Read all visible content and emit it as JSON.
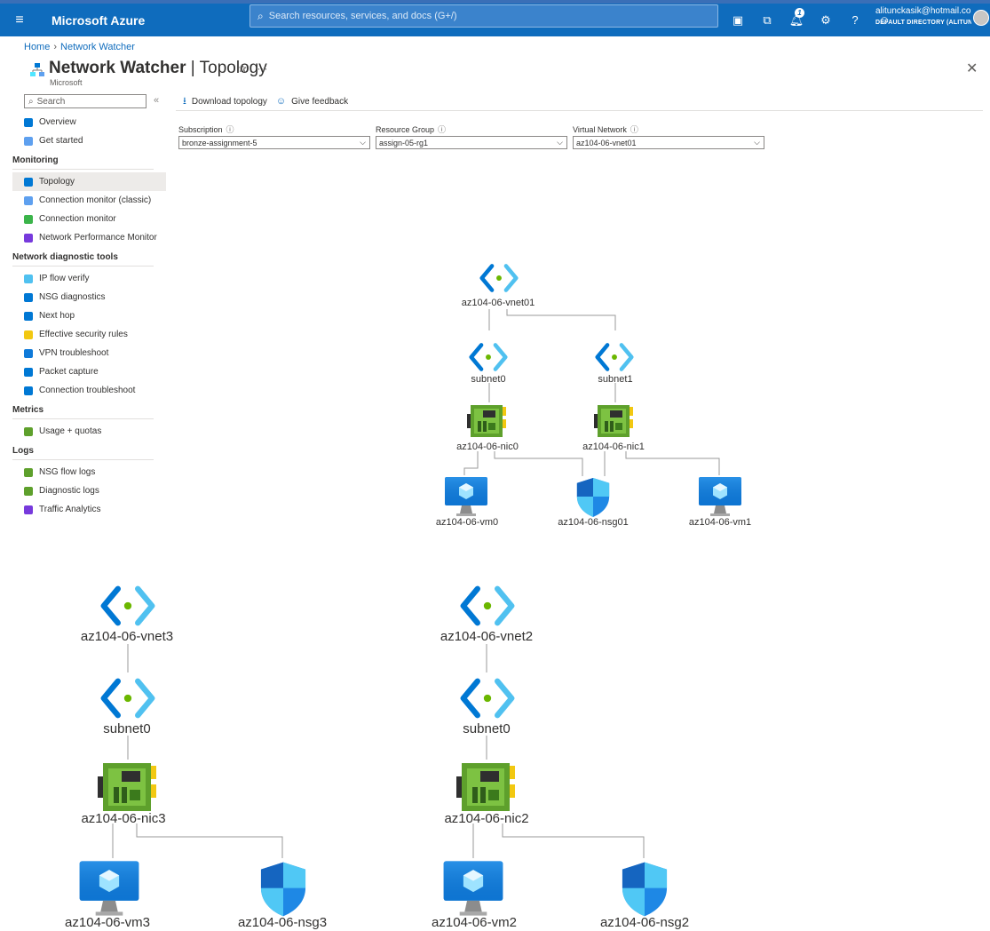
{
  "app": {
    "menu_glyph": "≡",
    "brand": "Microsoft Azure",
    "search_placeholder": "Search resources, services, and docs (G+/)",
    "notification_count": "1",
    "account_email": "alitunckasik@hotmail.co...",
    "account_directory": "DEFAULT DIRECTORY (ALITUNCK...",
    "accent_color": "#0f6cbd"
  },
  "breadcrumb": [
    "Home",
    "Network Watcher"
  ],
  "page": {
    "title_main": "Network Watcher",
    "title_sep": " | ",
    "title_sub": "Topology",
    "subtitle": "Microsoft"
  },
  "sidebar": {
    "search_placeholder": "Search",
    "items": [
      {
        "label": "Overview",
        "icon": "overview-icon",
        "section": false
      },
      {
        "label": "Get started",
        "icon": "get-started-icon",
        "section": false
      },
      {
        "label": "Monitoring",
        "section": true
      },
      {
        "label": "Topology",
        "icon": "topology-icon",
        "section": false,
        "active": true
      },
      {
        "label": "Connection monitor (classic)",
        "icon": "connection-monitor-classic-icon",
        "section": false
      },
      {
        "label": "Connection monitor",
        "icon": "connection-monitor-icon",
        "section": false
      },
      {
        "label": "Network Performance Monitor",
        "icon": "network-performance-monitor-icon",
        "section": false
      },
      {
        "label": "Network diagnostic tools",
        "section": true
      },
      {
        "label": "IP flow verify",
        "icon": "ip-flow-verify-icon",
        "section": false
      },
      {
        "label": "NSG diagnostics",
        "icon": "nsg-diagnostics-icon",
        "section": false
      },
      {
        "label": "Next hop",
        "icon": "next-hop-icon",
        "section": false
      },
      {
        "label": "Effective security rules",
        "icon": "effective-security-rules-icon",
        "section": false
      },
      {
        "label": "VPN troubleshoot",
        "icon": "vpn-troubleshoot-icon",
        "section": false
      },
      {
        "label": "Packet capture",
        "icon": "packet-capture-icon",
        "section": false
      },
      {
        "label": "Connection troubleshoot",
        "icon": "connection-troubleshoot-icon",
        "section": false
      },
      {
        "label": "Metrics",
        "section": true
      },
      {
        "label": "Usage + quotas",
        "icon": "usage-quotas-icon",
        "section": false
      },
      {
        "label": "Logs",
        "section": true
      },
      {
        "label": "NSG flow logs",
        "icon": "nsg-flow-logs-icon",
        "section": false
      },
      {
        "label": "Diagnostic logs",
        "icon": "diagnostic-logs-icon",
        "section": false
      },
      {
        "label": "Traffic Analytics",
        "icon": "traffic-analytics-icon",
        "section": false
      }
    ]
  },
  "toolbar": {
    "download_label": "Download topology",
    "feedback_label": "Give feedback"
  },
  "filters": {
    "subscription_label": "Subscription",
    "subscription_value": "bronze-assignment-5",
    "resource_group_label": "Resource Group",
    "resource_group_value": "assign-05-rg1",
    "virtual_network_label": "Virtual Network",
    "virtual_network_value": "az104-06-vnet01"
  },
  "topology": {
    "group1": {
      "vnet": "az104-06-vnet01",
      "subnets": [
        "subnet0",
        "subnet1"
      ],
      "nics": [
        "az104-06-nic0",
        "az104-06-nic1"
      ],
      "vms": [
        "az104-06-vm0",
        "az104-06-vm1"
      ],
      "nsg": "az104-06-nsg01"
    },
    "group2": {
      "vnet": "az104-06-vnet3",
      "subnet": "subnet0",
      "nic": "az104-06-nic3",
      "vm": "az104-06-vm3",
      "nsg": "az104-06-nsg3"
    },
    "group3": {
      "vnet": "az104-06-vnet2",
      "subnet": "subnet0",
      "nic": "az104-06-nic2",
      "vm": "az104-06-vm2",
      "nsg": "az104-06-nsg2"
    }
  }
}
